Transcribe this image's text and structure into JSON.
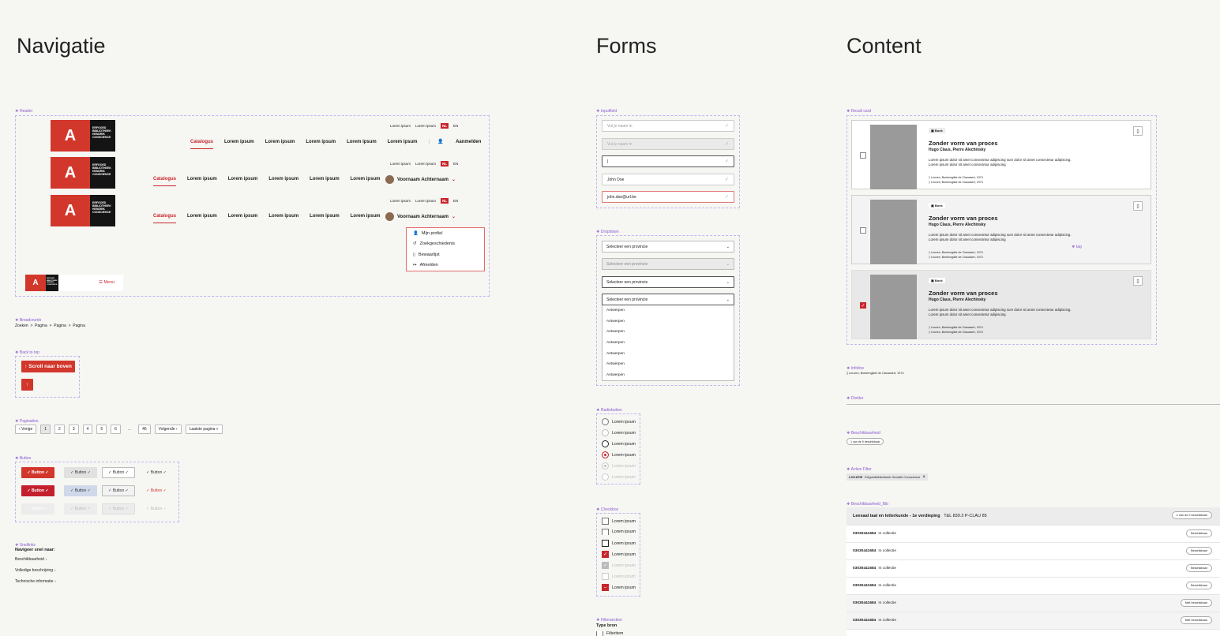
{
  "sections": {
    "navigatie": "Navigatie",
    "forms": "Forms",
    "content": "Content"
  },
  "labels": {
    "header": "Header",
    "breadcrumb": "Breadcrumb",
    "backtotop": "Back to top",
    "pagination": "Pagination",
    "button": "Button",
    "snellinks": "Snellinks",
    "inputfield": "Inputfield",
    "dropdown": "Dropdown",
    "radiobutton": "Radiobutton",
    "checkbox": "Checkbox",
    "filtersection": "Filtersection",
    "resultcard": "Result card",
    "infoline": "Infoline",
    "divider": "Divider",
    "beschikbaarheid": "Beschikbaarheid",
    "activefilter": "Active Filter",
    "beschikbaarheid_bib": "Beschikbaarheid_Bib"
  },
  "header": {
    "logo_letter": "A",
    "logo_text": "Erfgoed bibliotheek Hendrik Conscience",
    "util": {
      "l1": "Lorem ipsum",
      "l2": "Lorem ipsum",
      "nl": "NL",
      "en": "EN"
    },
    "nav": [
      "Catalogus",
      "Lorem ipsum",
      "Lorem ipsum",
      "Lorem ipsum",
      "Lorem ipsum",
      "Lorem ipsum"
    ],
    "login": "Aanmelden",
    "user": "Voornaam Achternaam",
    "menu_items": [
      "Mijn profiel",
      "Zoekgeschiedenis",
      "Bewaarlijst",
      "Afmelden"
    ],
    "mobile_menu": "Menu"
  },
  "breadcrumb": {
    "items": [
      "Zoeken",
      "Pagina",
      "Pagina",
      "Pagina"
    ],
    "sep": ">"
  },
  "backtotop": {
    "label": "Scroll naar boven",
    "icon": "↑"
  },
  "pagination": {
    "prev": "Vorige",
    "pages": [
      "1",
      "2",
      "3",
      "4",
      "5",
      "6"
    ],
    "dots": "...",
    "last_num": "46",
    "next": "Volgende",
    "last": "Laatste pagina"
  },
  "button": {
    "label": "Button"
  },
  "snellinks": {
    "title": "Navigeer snel naar:",
    "items": [
      "Beschikbaarheid ↓",
      "Volledige beschrijving ↓",
      "Technische informatie ↓"
    ]
  },
  "inputs": [
    "Vul je naam in",
    "Vul je naam in",
    "|",
    "John Doe",
    "john.doe@url.be"
  ],
  "dropdown": {
    "placeholder": "Selecteer een provincie",
    "options": [
      "Antwerpen",
      "Antwerpen",
      "Antwerpen",
      "Antwerpen",
      "Antwerpen",
      "Antwerpen",
      "Antwerpen"
    ]
  },
  "radio": {
    "label": "Lorem ipsum"
  },
  "checkbox": {
    "label": "Lorem ipsum"
  },
  "filtersection": {
    "title": "Type bron",
    "item": "Filteritem"
  },
  "card": {
    "tag": "Boek",
    "title": "Zonder vorm van proces",
    "authors": "Hugo Claus, Pierre Alechinsky",
    "desc1": "Lorem ipsum dolor sit amet consectetur adipiscing sum dolor sit amet consectetur adipiscing.",
    "desc2": "Lorem ipsum dolor sit amet consectetur adipiscing",
    "loc": "Leuven, Boekengilde de Clauwaert, 1974",
    "tag_label": "tag"
  },
  "infoline": {
    "text": "Leuven, Boekengilde de Clauwaert, 1974"
  },
  "beschikbaarheid": {
    "text": "1 van de 5 beschikbaar"
  },
  "activefilter": {
    "key": "LOCATIE",
    "value": "Erfgoedbibliotheek Hendrik Conscience"
  },
  "bib": {
    "head": "Leesaal taal en letterkunde - 1e verdieping",
    "code": "T&L 839.3 P-CLAU 85",
    "head_pill": "1 van de 2 beschikbaar",
    "rows": [
      {
        "id": "03030441684",
        "status": "In collectie",
        "pill": "Beschikbaar"
      },
      {
        "id": "03030441684",
        "status": "In collectie",
        "pill": "Beschikbaar"
      },
      {
        "id": "03030441684",
        "status": "In collectie",
        "pill": "Beschikbaar"
      },
      {
        "id": "03030441684",
        "status": "In collectie",
        "pill": "Beschikbaar"
      },
      {
        "id": "03030441684",
        "status": "In collectie",
        "pill": "Niet beschikbaar"
      },
      {
        "id": "03030441684",
        "status": "In collectie",
        "pill": "Niet beschikbaar"
      }
    ]
  }
}
